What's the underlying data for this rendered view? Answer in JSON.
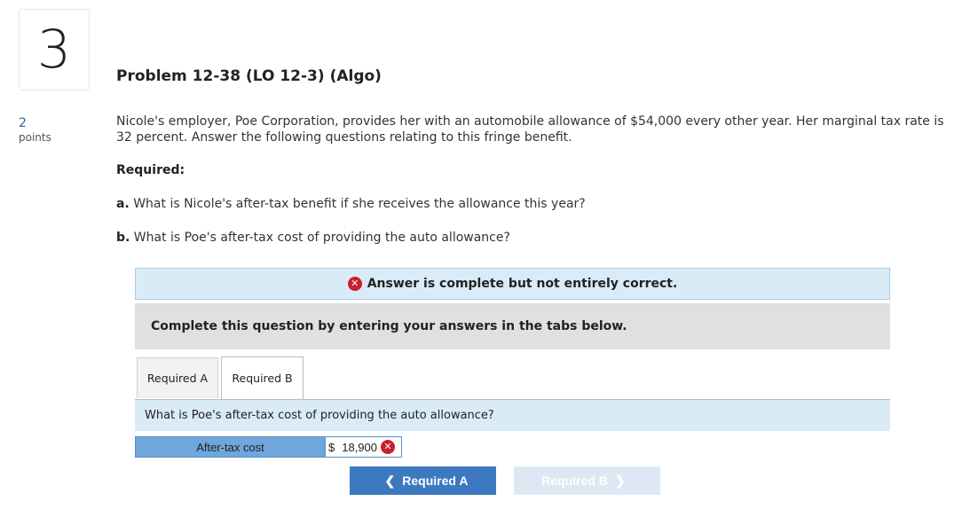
{
  "question": {
    "number": "3",
    "points_value": "2",
    "points_label": "points",
    "title": "Problem 12-38 (LO 12-3) (Algo)",
    "body": "Nicole's employer, Poe Corporation, provides her with an automobile allowance of $54,000 every other year. Her marginal tax rate is 32 percent. Answer the following questions relating to this fringe benefit.",
    "required_label": "Required:",
    "part_a_letter": "a.",
    "part_a_text": "What is Nicole's after-tax benefit if she receives the allowance this year?",
    "part_b_letter": "b.",
    "part_b_text": "What is Poe's after-tax cost of providing the auto allowance?"
  },
  "feedback": {
    "message": "Answer is complete but not entirely correct.",
    "status_color": "#c8202a"
  },
  "instruction": "Complete this question by entering your answers in the tabs below.",
  "tabs": [
    {
      "label": "Required A",
      "active": false
    },
    {
      "label": "Required B",
      "active": true
    }
  ],
  "panel": {
    "question": "What is Poe's after-tax cost of providing the auto allowance?",
    "answer_label": "After-tax cost",
    "currency": "$",
    "answer_value": "18,900"
  },
  "nav": {
    "prev_label": "Required A",
    "next_label": "Required B"
  },
  "colors": {
    "accent": "#3d79c0",
    "banner_bg": "#d9ebf7",
    "answer_label_bg": "#6fa6dc"
  },
  "icons": {
    "incorrect": "x-circle-icon",
    "prev": "chevron-left-icon",
    "next": "chevron-right-icon"
  }
}
